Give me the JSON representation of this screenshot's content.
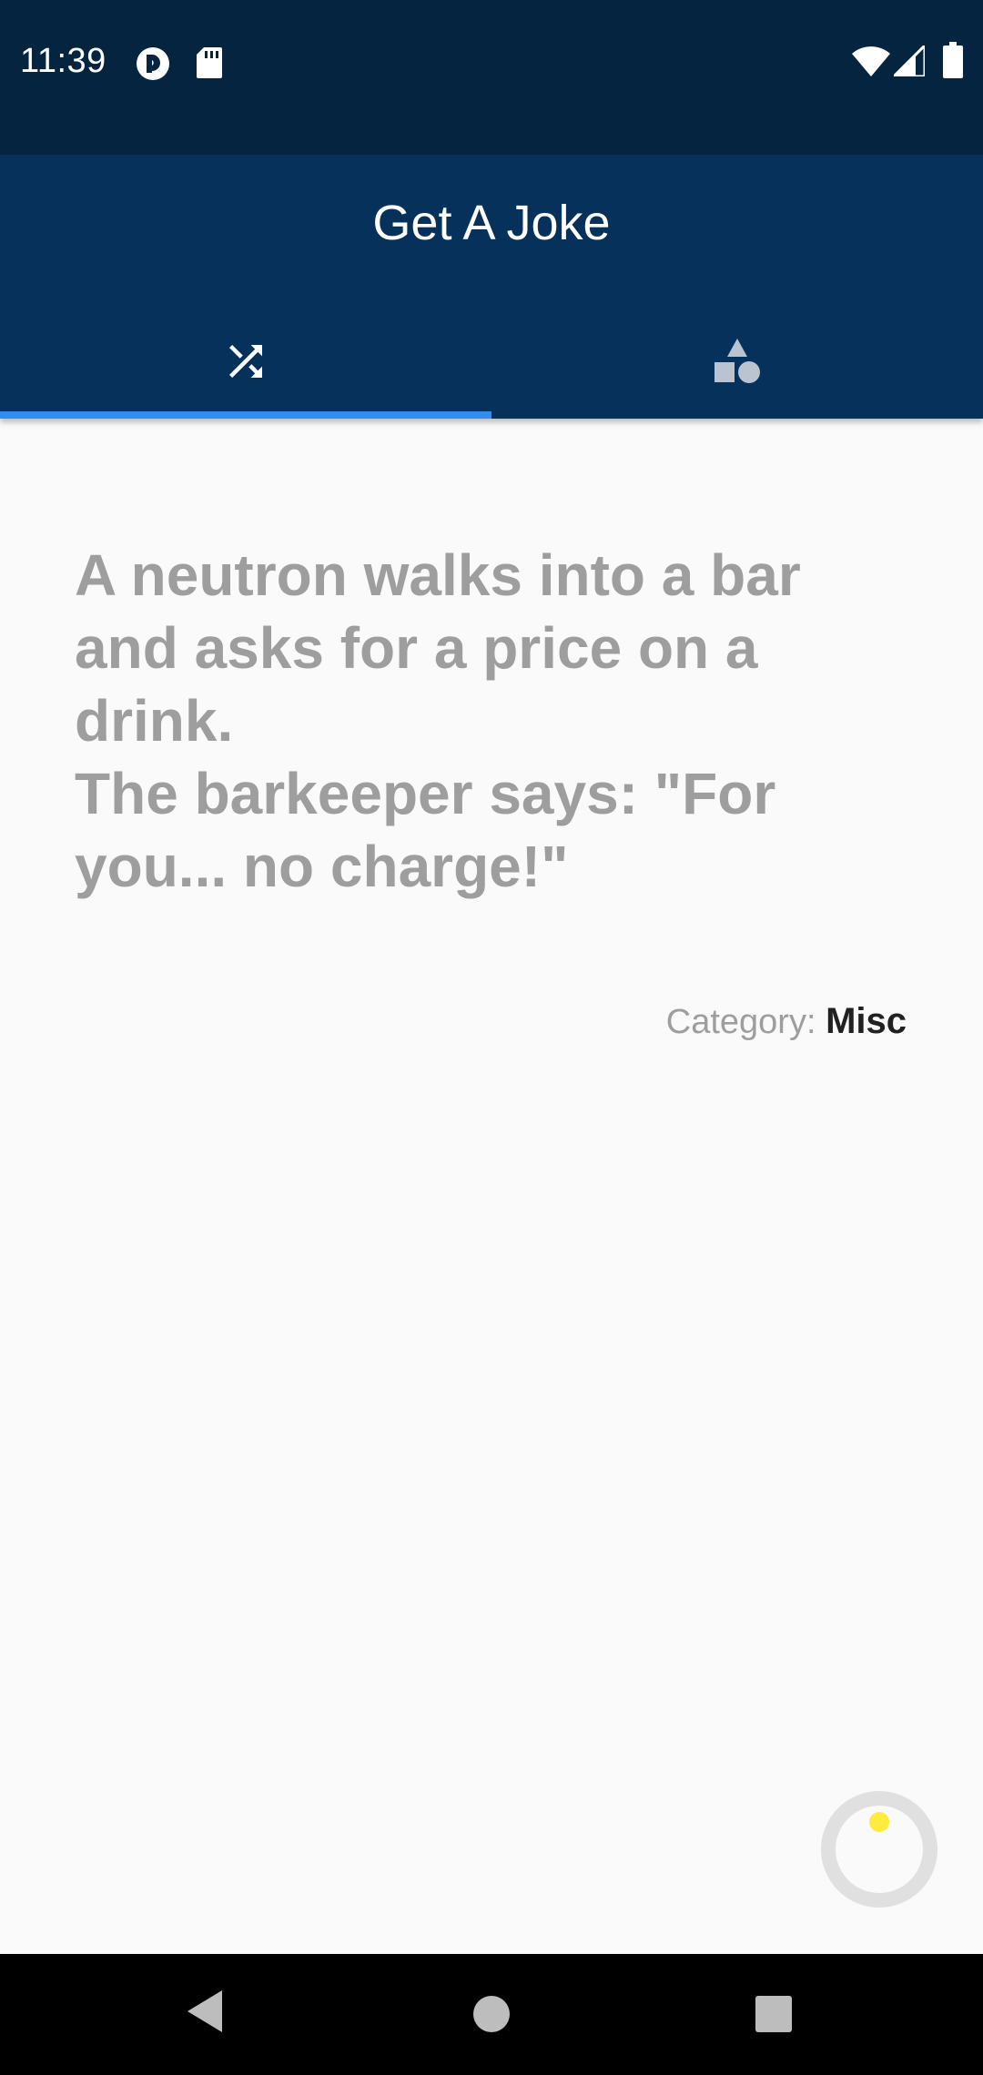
{
  "status_bar": {
    "time": "11:39",
    "icons": [
      "pocket-casts-icon",
      "sd-card-icon",
      "wifi-icon",
      "cell-signal-icon",
      "battery-icon"
    ]
  },
  "app_bar": {
    "title": "Get A Joke",
    "background": "#06315a",
    "tabs": [
      {
        "name": "random",
        "icon": "shuffle-icon",
        "selected": true
      },
      {
        "name": "categories",
        "icon": "category-shapes-icon",
        "selected": false
      }
    ],
    "indicator_color": "#2f8ff0"
  },
  "joke": {
    "text": "A neutron walks into a bar and asks for a price on a drink.\nThe barkeeper says: \"For you... no charge!\"",
    "category_label": "Category:",
    "category_value": "Misc"
  },
  "loader": {
    "icon": "loading-spinner-icon",
    "accent": "#ffeb3b"
  },
  "nav_bar": {
    "buttons": [
      "back-icon",
      "home-icon",
      "recents-icon"
    ]
  }
}
